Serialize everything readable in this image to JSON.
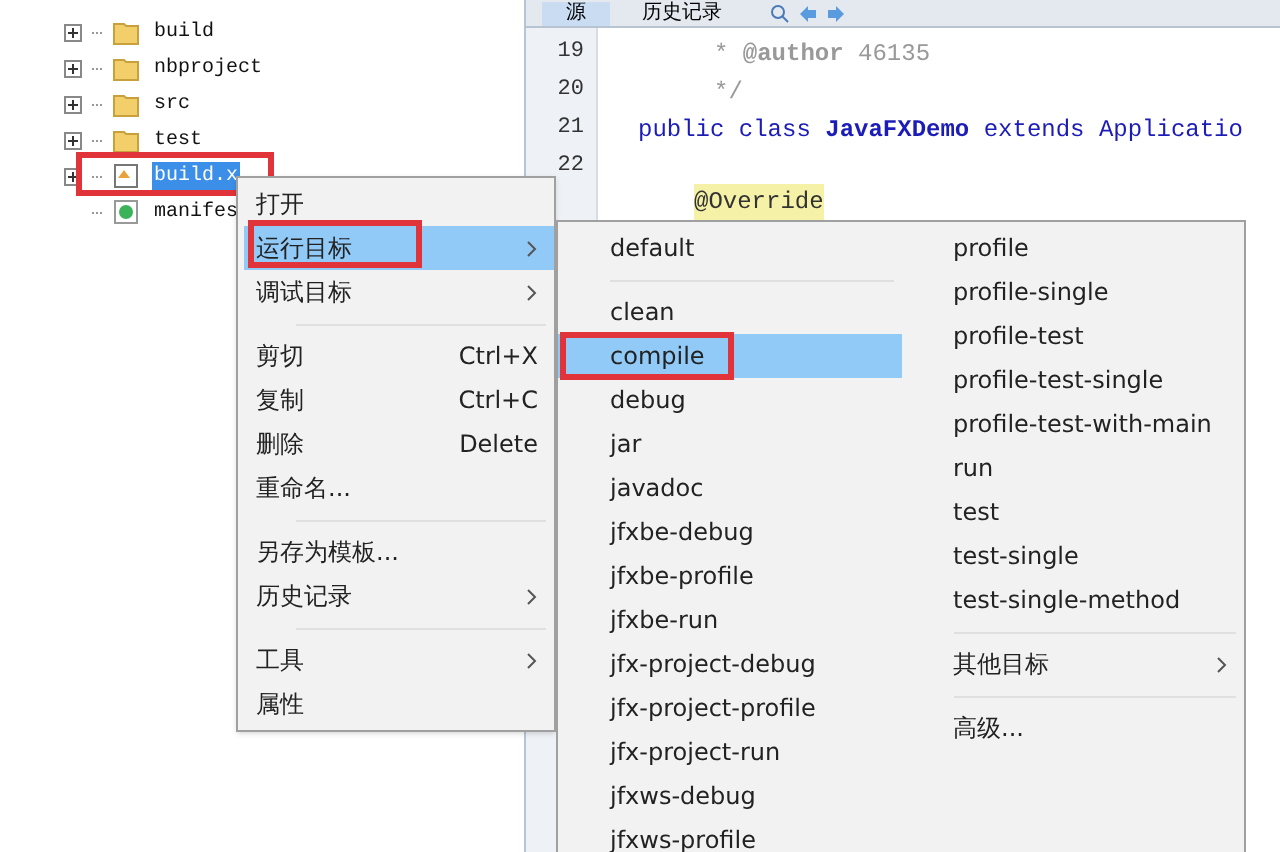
{
  "tree": [
    {
      "label": "build",
      "kind": "folder",
      "expandable": true,
      "selected": false
    },
    {
      "label": "nbproject",
      "kind": "folder",
      "expandable": true,
      "selected": false
    },
    {
      "label": "src",
      "kind": "folder",
      "expandable": true,
      "selected": false
    },
    {
      "label": "test",
      "kind": "folder",
      "expandable": true,
      "selected": false
    },
    {
      "label": "build.x",
      "kind": "xml",
      "expandable": true,
      "selected": true
    },
    {
      "label": "manifes",
      "kind": "manifest",
      "expandable": false,
      "selected": false
    }
  ],
  "editor": {
    "tabs": [
      {
        "label": "源",
        "selected": true
      },
      {
        "label": "历史记录",
        "selected": false
      }
    ],
    "lines": [
      {
        "number": "19",
        "code": "* **@author** 46135",
        "kind": "comment"
      },
      {
        "number": "20",
        "code": "*/",
        "kind": "comment"
      },
      {
        "number": "21",
        "code": "public class **JavaFXDemo** extends Applicatio",
        "kind": "code"
      },
      {
        "number": "22",
        "kind": "code"
      },
      {
        "code": "@Override",
        "kind": "annotation"
      }
    ]
  },
  "context_menu": {
    "items": [
      {
        "kind": "item",
        "label": "打开",
        "selected": false,
        "submenu": false
      },
      {
        "kind": "item",
        "label": "运行目标",
        "selected": true,
        "submenu": true
      },
      {
        "kind": "item",
        "label": "调试目标",
        "selected": false,
        "submenu": true
      },
      {
        "kind": "separator"
      },
      {
        "kind": "item",
        "label": "剪切",
        "shortcut": "Ctrl+X",
        "selected": false,
        "submenu": false
      },
      {
        "kind": "item",
        "label": "复制",
        "shortcut": "Ctrl+C",
        "selected": false,
        "submenu": false
      },
      {
        "kind": "item",
        "label": "删除",
        "shortcut": "Delete",
        "selected": false,
        "submenu": false
      },
      {
        "kind": "item",
        "label": "重命名...",
        "selected": false,
        "submenu": false
      },
      {
        "kind": "separator"
      },
      {
        "kind": "item",
        "label": "另存为模板...",
        "selected": false,
        "submenu": false
      },
      {
        "kind": "item",
        "label": "历史记录",
        "selected": false,
        "submenu": true
      },
      {
        "kind": "separator"
      },
      {
        "kind": "item",
        "label": "工具",
        "selected": false,
        "submenu": true
      },
      {
        "kind": "item",
        "label": "属性",
        "selected": false,
        "submenu": false
      }
    ]
  },
  "submenu": {
    "columns": [
      [
        {
          "kind": "item",
          "label": "default",
          "selected": false,
          "submenu": false
        },
        {
          "kind": "separator"
        },
        {
          "kind": "item",
          "label": "clean",
          "selected": false,
          "submenu": false
        },
        {
          "kind": "item",
          "label": "compile",
          "selected": true,
          "submenu": false
        },
        {
          "kind": "item",
          "label": "debug",
          "selected": false,
          "submenu": false
        },
        {
          "kind": "item",
          "label": "jar",
          "selected": false,
          "submenu": false
        },
        {
          "kind": "item",
          "label": "javadoc",
          "selected": false,
          "submenu": false
        },
        {
          "kind": "item",
          "label": "jfxbe-debug",
          "selected": false,
          "submenu": false
        },
        {
          "kind": "item",
          "label": "jfxbe-profile",
          "selected": false,
          "submenu": false
        },
        {
          "kind": "item",
          "label": "jfxbe-run",
          "selected": false,
          "submenu": false
        },
        {
          "kind": "item",
          "label": "jfx-project-debug",
          "selected": false,
          "submenu": false
        },
        {
          "kind": "item",
          "label": "jfx-project-profile",
          "selected": false,
          "submenu": false
        },
        {
          "kind": "item",
          "label": "jfx-project-run",
          "selected": false,
          "submenu": false
        },
        {
          "kind": "item",
          "label": "jfxws-debug",
          "selected": false,
          "submenu": false
        },
        {
          "kind": "item",
          "label": "jfxws-profile",
          "selected": false,
          "submenu": false
        }
      ],
      [
        {
          "kind": "item",
          "label": "profile",
          "selected": false,
          "submenu": false
        },
        {
          "kind": "item",
          "label": "profile-single",
          "selected": false,
          "submenu": false
        },
        {
          "kind": "item",
          "label": "profile-test",
          "selected": false,
          "submenu": false
        },
        {
          "kind": "item",
          "label": "profile-test-single",
          "selected": false,
          "submenu": false
        },
        {
          "kind": "item",
          "label": "profile-test-with-main",
          "selected": false,
          "submenu": false
        },
        {
          "kind": "item",
          "label": "run",
          "selected": false,
          "submenu": false
        },
        {
          "kind": "item",
          "label": "test",
          "selected": false,
          "submenu": false
        },
        {
          "kind": "item",
          "label": "test-single",
          "selected": false,
          "submenu": false
        },
        {
          "kind": "item",
          "label": "test-single-method",
          "selected": false,
          "submenu": false
        },
        {
          "kind": "separator"
        },
        {
          "kind": "item",
          "label": "其他目标",
          "selected": false,
          "submenu": true
        },
        {
          "kind": "separator"
        },
        {
          "kind": "item",
          "label": "高级...",
          "selected": false,
          "submenu": false
        }
      ]
    ]
  }
}
